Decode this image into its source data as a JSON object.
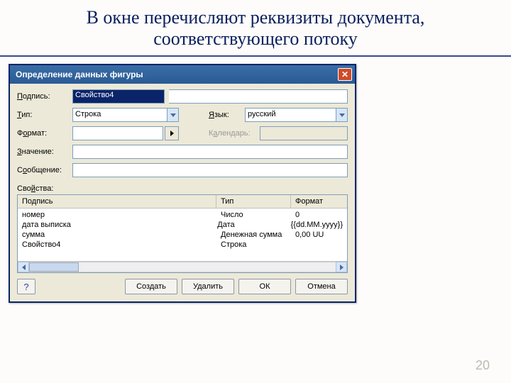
{
  "slide": {
    "title": "В окне перечисляют реквизиты документа, соответствующего потоку",
    "page_number": "20"
  },
  "dialog": {
    "title": "Определение данных фигуры",
    "close_glyph": "✕",
    "labels": {
      "podpis": "Подпись:",
      "tip": "Тип:",
      "yazyk": "Язык:",
      "format": "Формат:",
      "calendar": "Календарь:",
      "znachenie": "Значение:",
      "soobshenie": "Сообщение:",
      "svoystva": "Свойства:"
    },
    "fields": {
      "podpis_value": "Свойство4",
      "tip_value": "Строка",
      "yazyk_value": "русский",
      "format_value": "",
      "calendar_value": "",
      "znachenie_value": "",
      "soobshenie_value": ""
    },
    "grid": {
      "headers": {
        "c1": "Подпись",
        "c2": "Тип",
        "c3": "Формат"
      },
      "rows": [
        {
          "c1": "номер",
          "c2": "Число",
          "c3": "0"
        },
        {
          "c1": "дата выписка",
          "c2": "Дата",
          "c3": "{{dd.MM.yyyy}}"
        },
        {
          "c1": "сумма",
          "c2": "Денежная сумма",
          "c3": "0,00 UU"
        },
        {
          "c1": "Свойство4",
          "c2": "Строка",
          "c3": ""
        }
      ]
    },
    "buttons": {
      "help": "?",
      "create": "Создать",
      "delete": "Удалить",
      "ok": "ОК",
      "cancel": "Отмена"
    }
  }
}
